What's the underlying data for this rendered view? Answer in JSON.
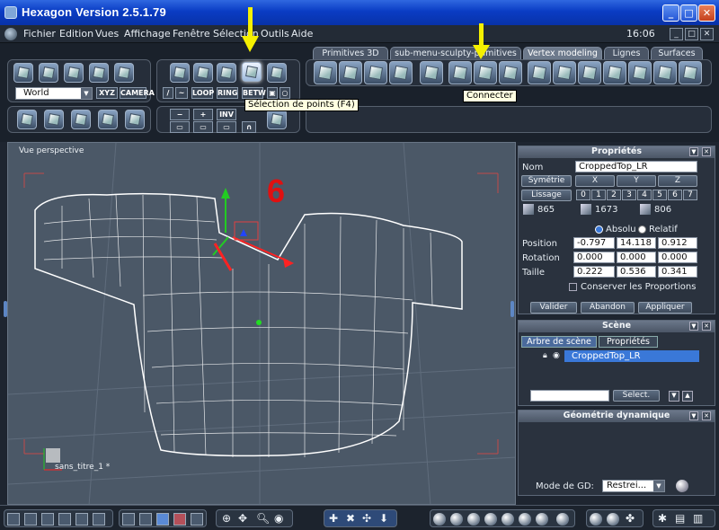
{
  "window": {
    "title": "Hexagon Version 2.5.1.79",
    "clock": "16:06"
  },
  "menu": [
    "Fichier",
    "Edition",
    "Vues",
    "Affichage",
    "Fenêtre",
    "Sélection",
    "Outils",
    "Aide"
  ],
  "tabs": [
    {
      "label": "Primitives 3D",
      "active": false
    },
    {
      "label": "sub-menu-sculpty-primitives",
      "active": false
    },
    {
      "label": "Vertex modeling",
      "active": true
    },
    {
      "label": "Lignes",
      "active": false
    },
    {
      "label": "Surfaces",
      "active": false
    }
  ],
  "toolbar": {
    "space_select": "World",
    "xyz": "XYZ",
    "camera": "CAMERA",
    "loop": "LOOP",
    "ring": "RING",
    "betw": "BETW",
    "minus": "−",
    "plus": "+",
    "inv": "INV"
  },
  "tooltips": {
    "selection": "Sélection de points (F4)",
    "connect": "Connecter"
  },
  "viewport": {
    "label": "Vue perspective",
    "overlay_number": "6",
    "file_label": "sans_titre_1 *"
  },
  "properties": {
    "title": "Propriétés",
    "name_label": "Nom",
    "name_value": "CroppedTop_LR",
    "symmetry_label": "Symétrie",
    "axes": [
      "X",
      "Y",
      "Z"
    ],
    "smoothing_label": "Lissage",
    "levels": [
      "0",
      "1",
      "2",
      "3",
      "4",
      "5",
      "6",
      "7"
    ],
    "counts": [
      "865",
      "1673",
      "806"
    ],
    "absolute": "Absolu",
    "relative": "Relatif",
    "rows": [
      {
        "label": "Position",
        "values": [
          "-0.797",
          "14.118",
          "0.912"
        ]
      },
      {
        "label": "Rotation",
        "values": [
          "0.000",
          "0.000",
          "0.000"
        ]
      },
      {
        "label": "Taille",
        "values": [
          "0.222",
          "0.536",
          "0.341"
        ]
      }
    ],
    "keep_proportions": "Conserver les Proportions",
    "validate": "Valider",
    "cancel": "Abandon",
    "apply": "Appliquer"
  },
  "scene": {
    "title": "Scène",
    "tab_tree": "Arbre de scène",
    "tab_props": "Propriétés",
    "item": "CroppedTop_LR",
    "select_btn": "Select."
  },
  "dyngeo": {
    "title": "Géométrie dynamique",
    "mode_label": "Mode de GD:",
    "mode_value": "Restrei..."
  },
  "colors": {
    "accent_blue": "#2f68e0",
    "mesh": "#ffffff",
    "annotation_red": "#e01010",
    "arrow_yellow": "#f5f000"
  }
}
